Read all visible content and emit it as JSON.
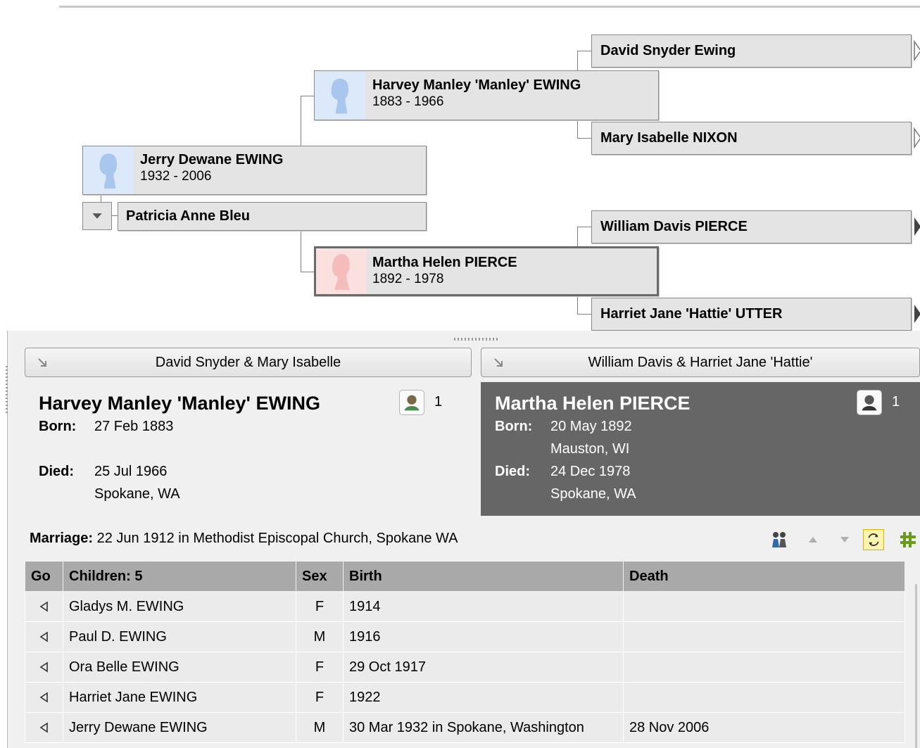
{
  "pedigree": {
    "root": {
      "name": "Jerry Dewane EWING",
      "dates": "1932 - 2006",
      "sex": "male"
    },
    "spouse": {
      "name": "Patricia Anne Bleu"
    },
    "father": {
      "name": "Harvey Manley 'Manley' EWING",
      "dates": "1883 - 1966",
      "sex": "male"
    },
    "mother": {
      "name": "Martha Helen PIERCE",
      "dates": "1892 - 1978",
      "sex": "female",
      "selected": true
    },
    "paternal_grandfather": {
      "name": "David Snyder Ewing"
    },
    "paternal_grandmother": {
      "name": "Mary Isabelle NIXON"
    },
    "maternal_grandfather": {
      "name": "William Davis PIERCE"
    },
    "maternal_grandmother": {
      "name": "Harriet Jane 'Hattie' UTTER"
    }
  },
  "family": {
    "husband_parents_label": "David Snyder & Mary Isabelle",
    "wife_parents_label": "William Davis & Harriet Jane 'Hattie'",
    "husband": {
      "name": "Harvey Manley 'Manley' EWING",
      "media_count": "1",
      "born_label": "Born:",
      "born_date": "27 Feb 1883",
      "died_label": "Died:",
      "died_date": "25 Jul 1966",
      "died_place": "Spokane, WA"
    },
    "wife": {
      "name": "Martha Helen PIERCE",
      "media_count": "1",
      "born_label": "Born:",
      "born_date": "20 May 1892",
      "born_place": "Mauston, WI",
      "died_label": "Died:",
      "died_date": "24 Dec 1978",
      "died_place": "Spokane, WA"
    },
    "marriage_label": "Marriage:",
    "marriage_text": "22 Jun 1912 in Methodist Episcopal Church, Spokane WA",
    "children_table": {
      "headers": {
        "go": "Go",
        "children": "Children: 5",
        "sex": "Sex",
        "birth": "Birth",
        "death": "Death"
      },
      "rows": [
        {
          "name": "Gladys M. EWING",
          "sex": "F",
          "birth": "1914",
          "death": ""
        },
        {
          "name": "Paul D. EWING",
          "sex": "M",
          "birth": "1916",
          "death": ""
        },
        {
          "name": "Ora Belle EWING",
          "sex": "F",
          "birth": "29 Oct 1917",
          "death": ""
        },
        {
          "name": "Harriet Jane EWING",
          "sex": "F",
          "birth": "1922",
          "death": ""
        },
        {
          "name": "Jerry Dewane EWING",
          "sex": "M",
          "birth": "30 Mar 1932 in Spokane, Washington",
          "death": "28 Nov 2006"
        }
      ]
    },
    "toolbar_icons": [
      "couple-icon",
      "move-up-icon",
      "move-down-icon",
      "swap-icon",
      "grid-icon"
    ]
  },
  "colors": {
    "male_photo_bg": "#dce9fb",
    "female_photo_bg": "#fbe0e0",
    "wife_card_bg": "#666666",
    "table_header_bg": "#a9a9a9"
  }
}
